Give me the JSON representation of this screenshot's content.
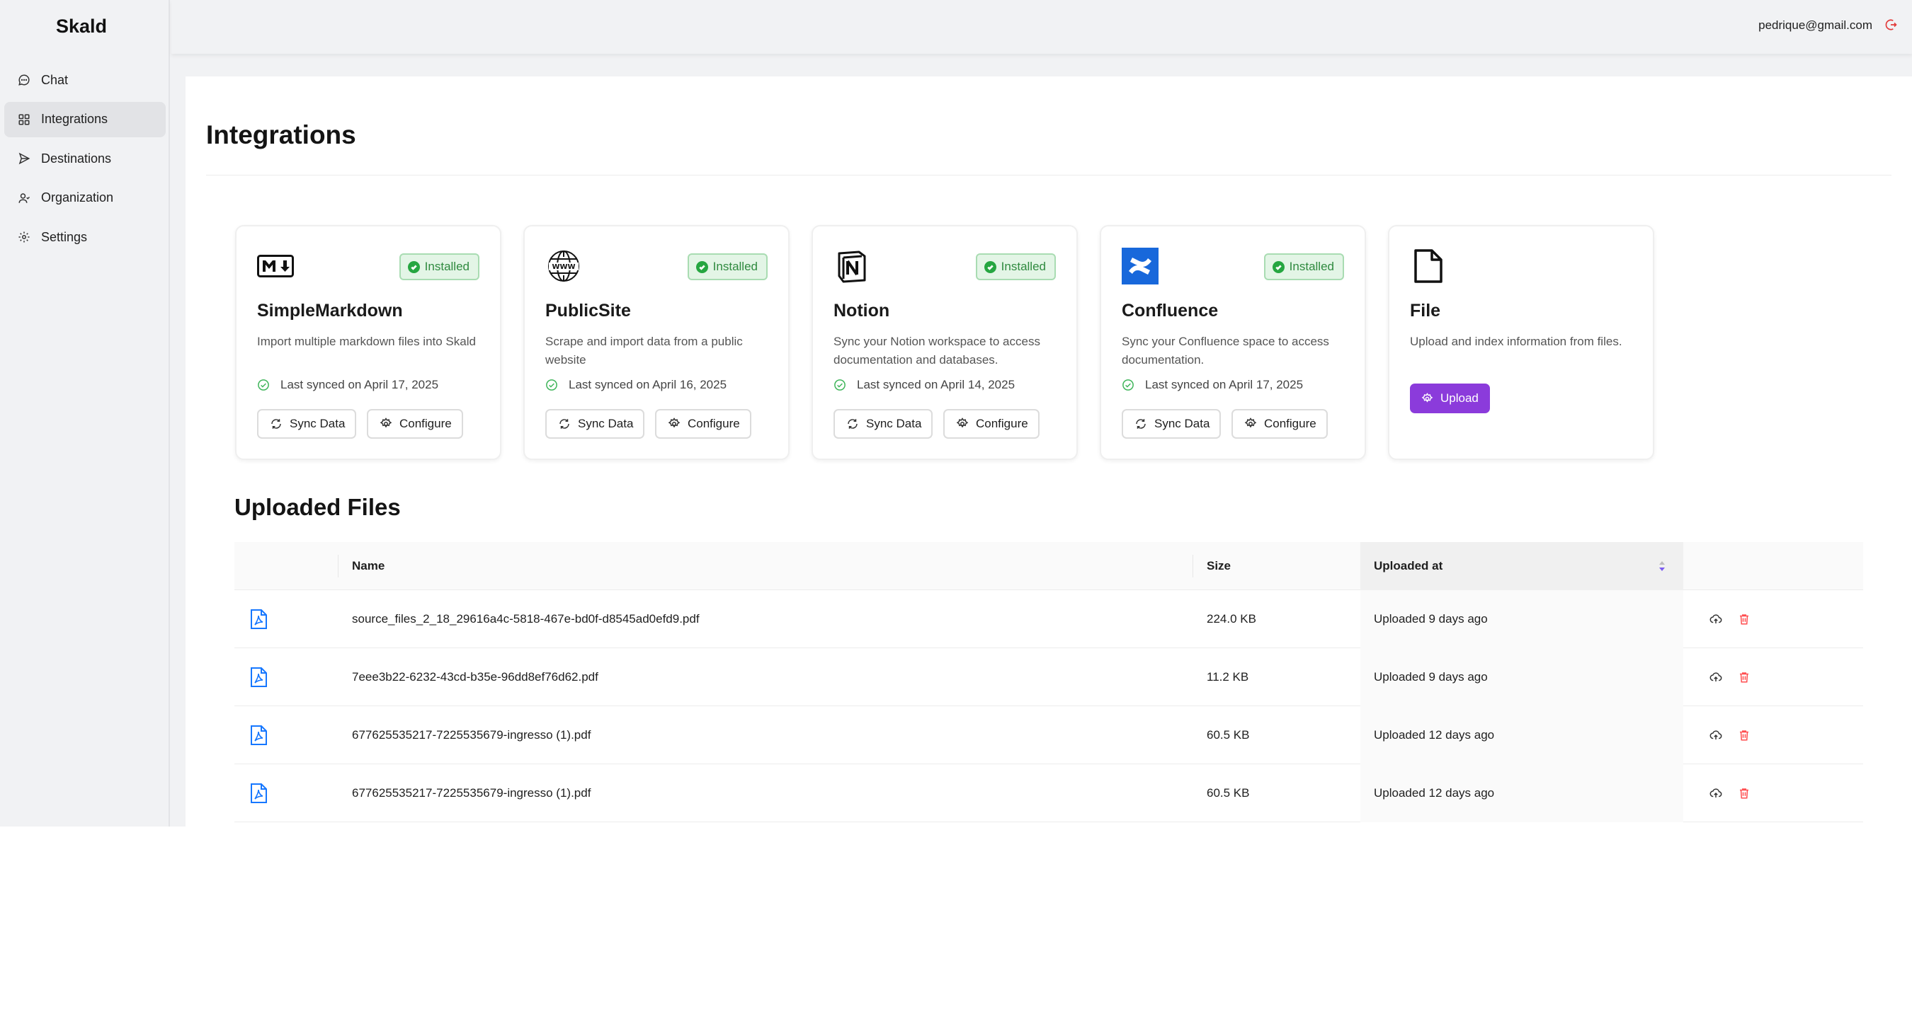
{
  "sidebar": {
    "brand": "Skald",
    "items": [
      {
        "label": "Chat",
        "icon": "chat-bubble-icon",
        "active": false
      },
      {
        "label": "Integrations",
        "icon": "grid-icon",
        "active": true
      },
      {
        "label": "Destinations",
        "icon": "send-icon",
        "active": false
      },
      {
        "label": "Organization",
        "icon": "users-icon",
        "active": false
      },
      {
        "label": "Settings",
        "icon": "gear-icon",
        "active": false
      }
    ]
  },
  "header": {
    "user_email": "pedrique@gmail.com",
    "logout_icon": "logout-icon"
  },
  "main": {
    "title": "Integrations"
  },
  "integrations": [
    {
      "name": "SimpleMarkdown",
      "logo": "markdown-logo",
      "status": "Installed",
      "description": "Import multiple markdown files into Skald",
      "last_synced": "Last synced on April 17, 2025",
      "sync_label": "Sync Data",
      "configure_label": "Configure"
    },
    {
      "name": "PublicSite",
      "logo": "www-globe-logo",
      "status": "Installed",
      "description": "Scrape and import data from a public website",
      "last_synced": "Last synced on April 16, 2025",
      "sync_label": "Sync Data",
      "configure_label": "Configure"
    },
    {
      "name": "Notion",
      "logo": "notion-logo",
      "status": "Installed",
      "description": "Sync your Notion workspace to access documentation and databases.",
      "last_synced": "Last synced on April 14, 2025",
      "sync_label": "Sync Data",
      "configure_label": "Configure"
    },
    {
      "name": "Confluence",
      "logo": "confluence-logo",
      "status": "Installed",
      "description": "Sync your Confluence space to access documentation.",
      "last_synced": "Last synced on April 17, 2025",
      "sync_label": "Sync Data",
      "configure_label": "Configure"
    },
    {
      "name": "File",
      "logo": "file-icon",
      "description": "Upload and index information from files.",
      "upload_label": "Upload"
    }
  ],
  "uploaded_files": {
    "title": "Uploaded Files",
    "columns": {
      "name": "Name",
      "size": "Size",
      "uploaded_at": "Uploaded at"
    },
    "sorted_column": "uploaded_at",
    "colors": {
      "pdf_icon": "#1677ff",
      "delete_icon": "#ff4d4f",
      "upload_button": "#8b3bdb",
      "installed_badge": "#2f8a3f"
    },
    "rows": [
      {
        "name": "source_files_2_18_29616a4c-5818-467e-bd0f-d8545ad0efd9.pdf",
        "size": "224.0 KB",
        "uploaded_at": "Uploaded 9 days ago"
      },
      {
        "name": "7eee3b22-6232-43cd-b35e-96dd8ef76d62.pdf",
        "size": "11.2 KB",
        "uploaded_at": "Uploaded 9 days ago"
      },
      {
        "name": "677625535217-7225535679-ingresso (1).pdf",
        "size": "60.5 KB",
        "uploaded_at": "Uploaded 12 days ago"
      },
      {
        "name": "677625535217-7225535679-ingresso (1).pdf",
        "size": "60.5 KB",
        "uploaded_at": "Uploaded 12 days ago"
      }
    ]
  }
}
